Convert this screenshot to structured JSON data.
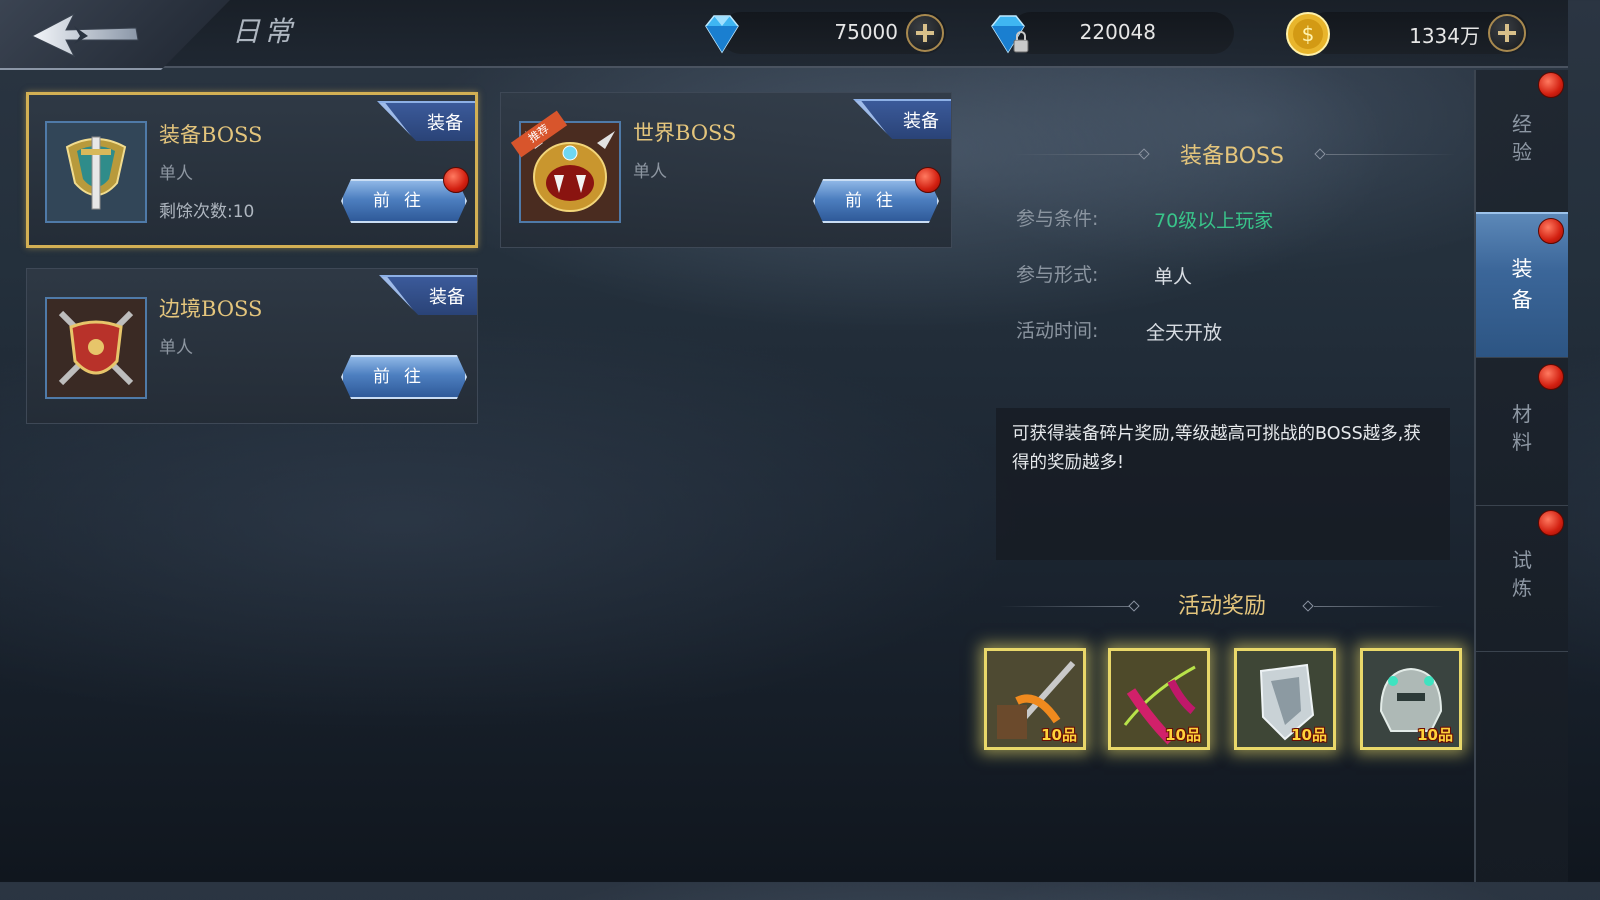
{
  "header": {
    "title": "日常",
    "currencies": [
      {
        "name": "diamond",
        "value": "75000"
      },
      {
        "name": "bound-diamond",
        "value": "220048"
      },
      {
        "name": "gold",
        "value": "1334万"
      }
    ]
  },
  "cards": [
    {
      "title": "装备BOSS",
      "mode": "单人",
      "remaining": "剩馀次数:10",
      "tag": "装备",
      "button": "前往",
      "has_dot": true,
      "selected": true
    },
    {
      "title": "世界BOSS",
      "mode": "单人",
      "tag": "装备",
      "button": "前往",
      "has_dot": true,
      "recommend": "推荐"
    },
    {
      "title": "边境BOSS",
      "mode": "单人",
      "tag": "装备",
      "button": "前往",
      "has_dot": false
    }
  ],
  "detail": {
    "title": "装备BOSS",
    "condition_label": "参与条件:",
    "condition_value": "70级以上玩家",
    "form_label": "参与形式:",
    "form_value": "单人",
    "time_label": "活动时间:",
    "time_value": "全天开放",
    "description": "可获得装备碎片奖励,等级越高可挑战的BOSS越多,获得的奖励越多!",
    "rewards_title": "活动奖励",
    "rewards": [
      {
        "name": "weapon-fragment",
        "count": "10品"
      },
      {
        "name": "blade-fragment",
        "count": "10品"
      },
      {
        "name": "armor-fragment",
        "count": "10品"
      },
      {
        "name": "helmet-fragment",
        "count": "10品"
      }
    ]
  },
  "tabs": [
    {
      "label": "经\n验",
      "active": false
    },
    {
      "label": "装\n备",
      "active": true
    },
    {
      "label": "材\n料",
      "active": false
    },
    {
      "label": "试\n炼",
      "active": false
    }
  ],
  "colors": {
    "accent_gold": "#e4c57c",
    "condition_green": "#39c48a",
    "button_blue": "#4d7fc0",
    "badge_red": "#d21f10"
  }
}
